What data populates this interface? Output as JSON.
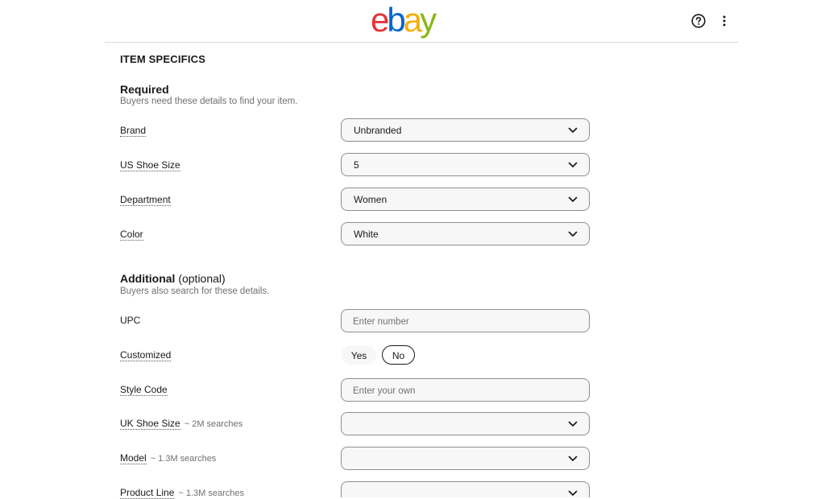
{
  "header": {
    "logo": {
      "letters": [
        "e",
        "b",
        "a",
        "y"
      ],
      "colors": [
        "#e53238",
        "#0064d2",
        "#f5af02",
        "#86b817"
      ]
    },
    "help_icon": "help-circle-icon",
    "more_icon": "more-vertical-icon"
  },
  "section_title": "ITEM SPECIFICS",
  "required": {
    "title": "Required",
    "subtitle": "Buyers need these details to find your item.",
    "fields": [
      {
        "label": "Brand",
        "value": "Unbranded"
      },
      {
        "label": "US Shoe Size",
        "value": "5"
      },
      {
        "label": "Department",
        "value": "Women"
      },
      {
        "label": "Color",
        "value": "White"
      }
    ]
  },
  "additional": {
    "title": "Additional",
    "title_suffix": " (optional)",
    "subtitle": "Buyers also search for these details.",
    "upc": {
      "label": "UPC",
      "placeholder": "Enter number"
    },
    "customized": {
      "label": "Customized",
      "yes": "Yes",
      "no": "No",
      "selected": "No"
    },
    "style_code": {
      "label": "Style Code",
      "placeholder": "Enter your own"
    },
    "uk_shoe_size": {
      "label": "UK Shoe Size",
      "hint": "~ 2M searches",
      "value": ""
    },
    "model": {
      "label": "Model",
      "hint": "~ 1.3M searches",
      "value": ""
    },
    "product_line": {
      "label": "Product Line",
      "hint": "~ 1.3M searches",
      "value": ""
    }
  }
}
